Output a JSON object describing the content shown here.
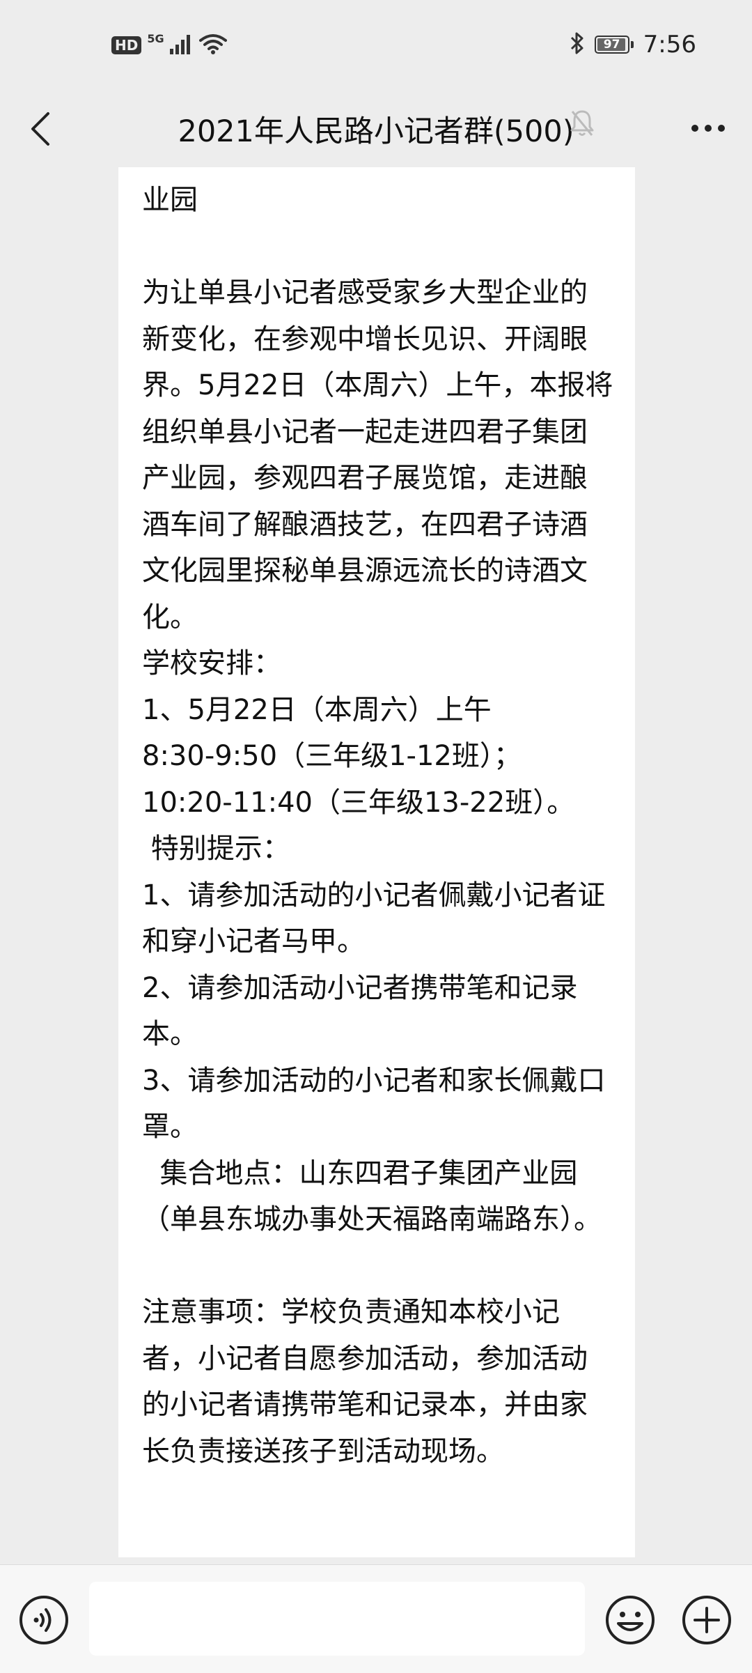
{
  "status_bar": {
    "hd_label": "HD",
    "network_label": "5G",
    "battery_level": "97",
    "battery_fraction": 0.97,
    "time": "7:56",
    "icons": [
      "signal-icon",
      "wifi-icon",
      "bluetooth-icon",
      "battery-icon"
    ]
  },
  "header": {
    "title": "2021年人民路小记者群(500)",
    "icons": [
      "back-chevron-icon",
      "mute-bell-icon",
      "more-dots-icon"
    ]
  },
  "message": {
    "text": "业园\n\n为让单县小记者感受家乡大型企业的新变化，在参观中增长见识、开阔眼界。5月22日（本周六）上午，本报将组织单县小记者一起走进四君子集团产业园，参观四君子展览馆，走进酿酒车间了解酿酒技艺，在四君子诗酒文化园里探秘单县源远流长的诗酒文化。\n学校安排：\n1、5月22日（本周六）上午\n8:30-9:50（三年级1-12班）；\n10:20-11:40（三年级13-22班）。\n 特别提示：\n1、请参加活动的小记者佩戴小记者证和穿小记者马甲。\n2、请参加活动小记者携带笔和记录本。\n3、请参加活动的小记者和家长佩戴口罩。\n  集合地点：山东四君子集团产业园（单县东城办事处天福路南端路东）。\n\n注意事项：学校负责通知本校小记者，小记者自愿参加活动，参加活动的小记者请携带笔和记录本，并由家长负责接送孩子到活动现场。"
  },
  "input_bar": {
    "input_value": "",
    "icons": [
      "voice-icon",
      "emoji-icon",
      "plus-icon"
    ]
  },
  "colors": {
    "background": "#ededed",
    "card": "#ffffff",
    "text": "#111111",
    "bottom_bar": "#f7f7f7"
  }
}
